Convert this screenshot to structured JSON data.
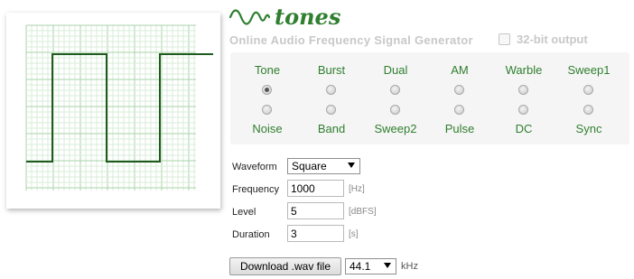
{
  "header": {
    "logo_text": "tones",
    "tagline": "Online Audio Frequency Signal Generator",
    "option_32bit_label": "32-bit output",
    "option_32bit_checked": false
  },
  "colors": {
    "accent_green": "#2f7f2f",
    "waveform": "#1f5a1f",
    "grid_minor": "#d8ecd8",
    "grid_major": "#a9d3a9"
  },
  "modes": [
    {
      "top": "Tone",
      "bottom": "Noise",
      "top_checked": true
    },
    {
      "top": "Burst",
      "bottom": "Band",
      "top_checked": false
    },
    {
      "top": "Dual",
      "bottom": "Sweep2",
      "top_checked": false
    },
    {
      "top": "AM",
      "bottom": "Pulse",
      "top_checked": false
    },
    {
      "top": "Warble",
      "bottom": "DC",
      "top_checked": false
    },
    {
      "top": "Sweep1",
      "bottom": "Sync",
      "top_checked": false
    }
  ],
  "form": {
    "waveform_label": "Waveform",
    "waveform_value": "Square",
    "frequency_label": "Frequency",
    "frequency_value": "1000",
    "frequency_unit": "[Hz]",
    "level_label": "Level",
    "level_value": "5",
    "level_unit": "[dBFS]",
    "duration_label": "Duration",
    "duration_value": "3",
    "duration_unit": "[s]"
  },
  "download": {
    "button_label": "Download .wav file",
    "sample_rate_value": "44.1",
    "sample_rate_unit": "kHz"
  },
  "icons": {
    "logo": "sine-wave-icon",
    "scope": "square-wave-scope"
  }
}
